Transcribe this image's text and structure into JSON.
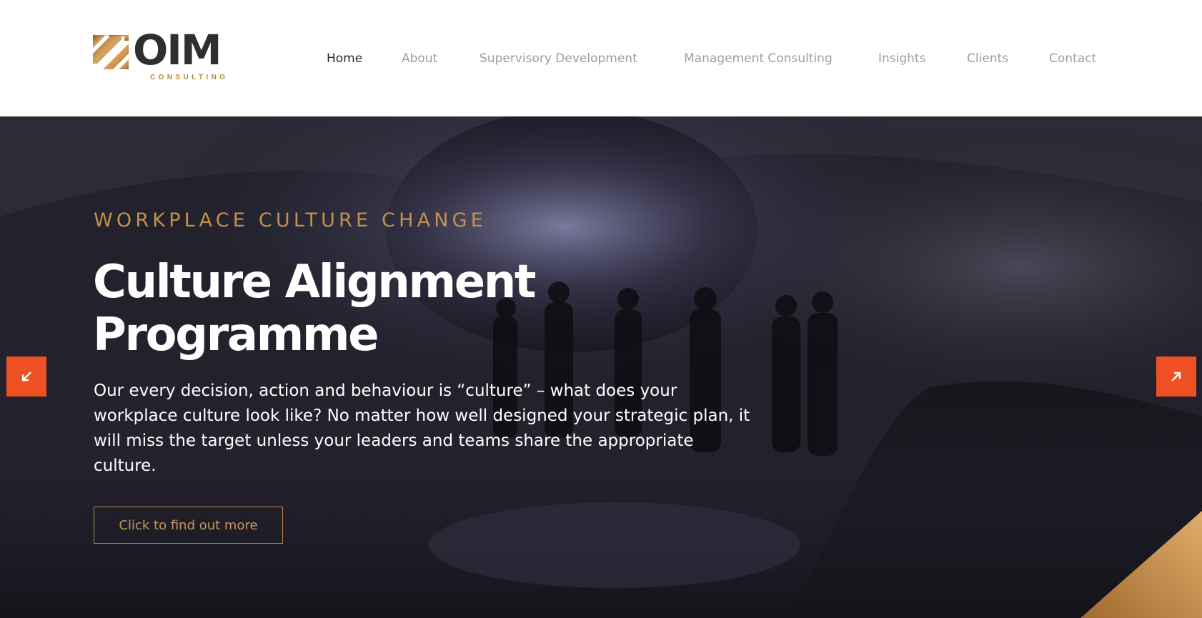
{
  "brand": {
    "name": "OIM",
    "subtitle": "CONSULTING",
    "accent": "#c1914d"
  },
  "nav": {
    "items": [
      {
        "label": "Home",
        "active": true
      },
      {
        "label": "About",
        "active": false
      },
      {
        "label": "Supervisory Development",
        "active": false
      },
      {
        "label": "Management Consulting",
        "active": false
      },
      {
        "label": "Insights",
        "active": false
      },
      {
        "label": "Clients",
        "active": false
      },
      {
        "label": "Contact",
        "active": false
      }
    ]
  },
  "hero": {
    "eyebrow": "WORKPLACE CULTURE CHANGE",
    "title_line1": "Culture Alignment",
    "title_line2": "Programme",
    "body": "Our every decision, action and behaviour is “culture” – what does your workplace culture look like? No matter how well designed your strategic plan, it will miss the target unless your leaders and teams share the appropriate culture.",
    "cta_label": "Click to find out more",
    "prev_icon": "arrow-down-left-icon",
    "next_icon": "arrow-up-right-icon",
    "arrow_color": "#ef5023"
  }
}
